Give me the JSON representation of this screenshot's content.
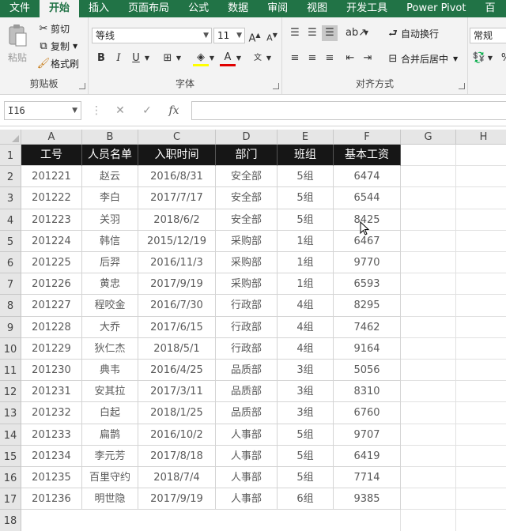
{
  "menu": {
    "tabs": [
      "文件",
      "开始",
      "插入",
      "页面布局",
      "公式",
      "数据",
      "审阅",
      "视图",
      "开发工具",
      "Power Pivot",
      "百"
    ],
    "active_index": 1
  },
  "ribbon": {
    "clipboard": {
      "paste": "粘贴",
      "cut": "剪切",
      "copy": "复制",
      "format_painter": "格式刷",
      "label": "剪贴板"
    },
    "font": {
      "name": "等线",
      "size": "11",
      "bold": "B",
      "italic": "I",
      "underline": "U",
      "label": "字体"
    },
    "alignment": {
      "wrap_text": "自动换行",
      "merge_center": "合并后居中",
      "label": "对齐方式"
    },
    "number": {
      "format": "常规"
    }
  },
  "formula_bar": {
    "name_box": "I16",
    "fx": "fx",
    "value": ""
  },
  "sheet": {
    "columns": [
      "A",
      "B",
      "C",
      "D",
      "E",
      "F",
      "G",
      "H"
    ],
    "rows": [
      "1",
      "2",
      "3",
      "4",
      "5",
      "6",
      "7",
      "8",
      "9",
      "10",
      "11",
      "12",
      "13",
      "14",
      "15",
      "16",
      "17",
      "18"
    ],
    "headers": [
      "工号",
      "人员名单",
      "入职时间",
      "部门",
      "班组",
      "基本工资"
    ],
    "data": [
      [
        "201221",
        "赵云",
        "2016/8/31",
        "安全部",
        "5组",
        "6474"
      ],
      [
        "201222",
        "李白",
        "2017/7/17",
        "安全部",
        "5组",
        "6544"
      ],
      [
        "201223",
        "关羽",
        "2018/6/2",
        "安全部",
        "5组",
        "8425"
      ],
      [
        "201224",
        "韩信",
        "2015/12/19",
        "采购部",
        "1组",
        "6467"
      ],
      [
        "201225",
        "后羿",
        "2016/11/3",
        "采购部",
        "1组",
        "9770"
      ],
      [
        "201226",
        "黄忠",
        "2017/9/19",
        "采购部",
        "1组",
        "6593"
      ],
      [
        "201227",
        "程咬金",
        "2016/7/30",
        "行政部",
        "4组",
        "8295"
      ],
      [
        "201228",
        "大乔",
        "2017/6/15",
        "行政部",
        "4组",
        "7462"
      ],
      [
        "201229",
        "狄仁杰",
        "2018/5/1",
        "行政部",
        "4组",
        "9164"
      ],
      [
        "201230",
        "典韦",
        "2016/4/25",
        "品质部",
        "3组",
        "5056"
      ],
      [
        "201231",
        "安其拉",
        "2017/3/11",
        "品质部",
        "3组",
        "8310"
      ],
      [
        "201232",
        "白起",
        "2018/1/25",
        "品质部",
        "3组",
        "6760"
      ],
      [
        "201233",
        "扁鹊",
        "2016/10/2",
        "人事部",
        "5组",
        "9707"
      ],
      [
        "201234",
        "李元芳",
        "2017/8/18",
        "人事部",
        "5组",
        "6419"
      ],
      [
        "201235",
        "百里守约",
        "2018/7/4",
        "人事部",
        "5组",
        "7714"
      ],
      [
        "201236",
        "明世隐",
        "2017/9/19",
        "人事部",
        "6组",
        "9385"
      ]
    ]
  },
  "colors": {
    "brand": "#217346",
    "header_fill": "#161616"
  }
}
